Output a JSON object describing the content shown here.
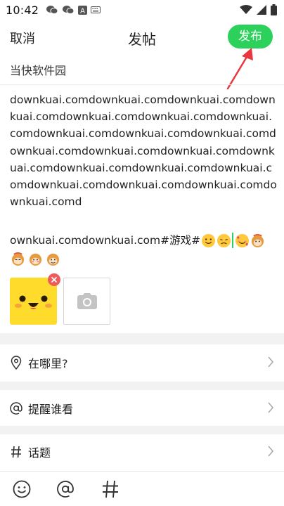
{
  "status_bar": {
    "time": "10:42",
    "icons_left": [
      "wechat-icon",
      "wechat-icon",
      "a-icon",
      "keyboard-icon"
    ],
    "icons_right": [
      "wifi-icon",
      "signal-icon",
      "battery-icon"
    ]
  },
  "header": {
    "cancel_label": "取消",
    "title": "发帖",
    "publish_label": "发布"
  },
  "forum": {
    "name": "当快软件园"
  },
  "post": {
    "body": "downkuai.comdownkuai.comdownkuai.comdownkuai.comdownkuai.comdownkuai.comdownkuai.comdownkuai.comdownkuai.comdownkuai.comdownkuai.comdownkuai.comdownkuai.comdownkuai.comdownkuai.comdownkuai.comdownkuai.comdownkuai.comdownkuai.comdownkuai.comdownkuai.comd",
    "last_line": "ownkuai.comdownkuai.com#游戏#",
    "emoji_inline": [
      "smile-emoji",
      "sad-emoji",
      "love-emoji",
      "monkey-emoji"
    ],
    "emoji_row": [
      "monkey-emoji",
      "monkey-emoji",
      "monkey-emoji"
    ]
  },
  "rows": {
    "location_label": "在哪里?",
    "mention_label": "提醒谁看",
    "topic_label": "话题"
  },
  "colors": {
    "accent": "#2bd15a",
    "arrow": "#e8383d",
    "remove": "#f05a5a",
    "thumb": "#ffdb2c"
  }
}
